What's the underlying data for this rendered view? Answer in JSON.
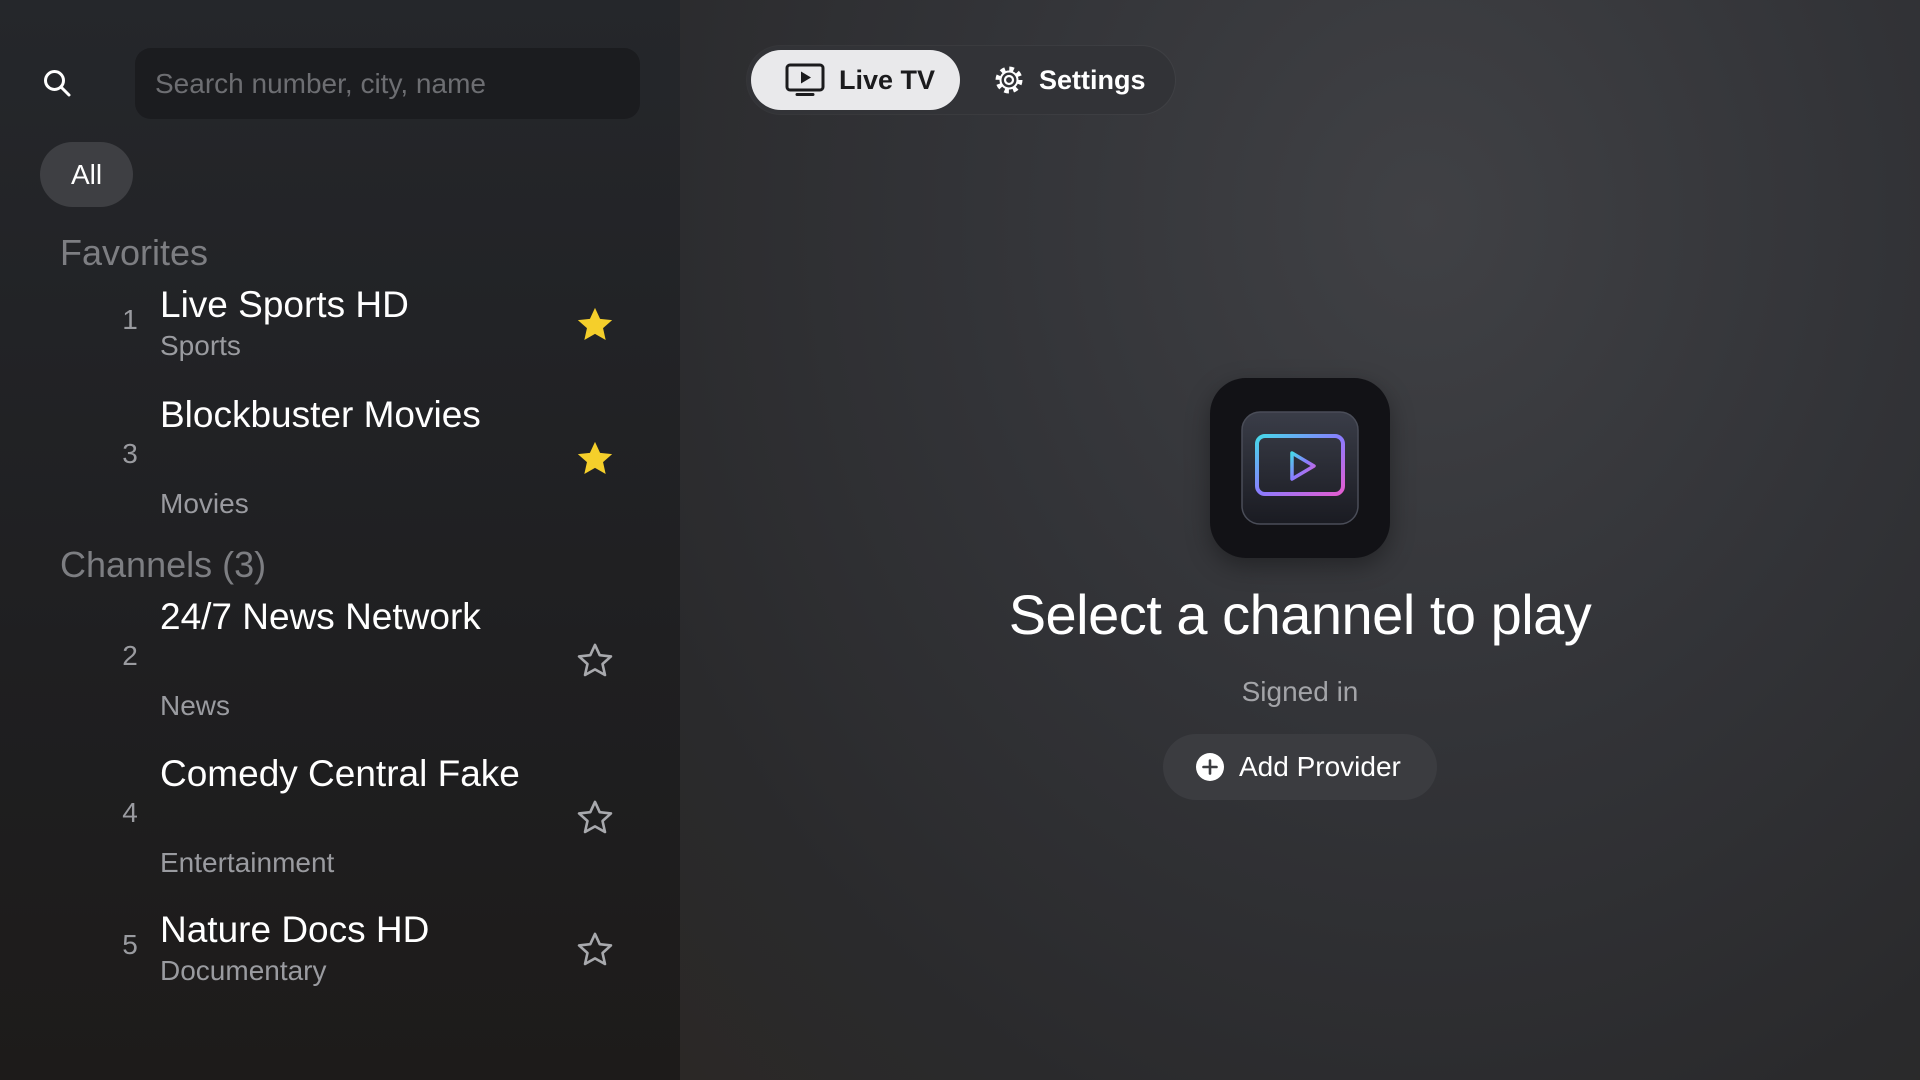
{
  "sidebar": {
    "search": {
      "placeholder": "Search number, city, name"
    },
    "filter_all": "All",
    "favorites_title": "Favorites",
    "favorites": [
      {
        "number": "1",
        "name": "Live Sports HD",
        "category": "Sports",
        "favorite": true
      },
      {
        "number": "3",
        "name": "Blockbuster Movies",
        "category": "Movies",
        "favorite": true
      }
    ],
    "channels_title": "Channels (3)",
    "channels": [
      {
        "number": "2",
        "name": "24/7 News Network",
        "category": "News",
        "favorite": false
      },
      {
        "number": "4",
        "name": "Comedy Central Fake",
        "category": "Entertainment",
        "favorite": false
      },
      {
        "number": "5",
        "name": "Nature Docs HD",
        "category": "Documentary",
        "favorite": false
      }
    ]
  },
  "tabs": {
    "live_tv": "Live TV",
    "settings": "Settings",
    "active": "live_tv"
  },
  "main": {
    "headline": "Select a channel to play",
    "status": "Signed in",
    "add_provider_label": "Add Provider"
  },
  "colors": {
    "star_active": "#f5cf2b",
    "star_inactive": "#a8a9ad",
    "tab_active_bg": "#e9e9eb"
  },
  "icons": {
    "search": "search-icon",
    "star_filled": "star-filled-icon",
    "star_outline": "star-outline-icon",
    "tv": "tv-play-icon",
    "gear": "gear-icon",
    "plus_circle": "plus-circle-icon",
    "app": "app-logo-icon"
  }
}
